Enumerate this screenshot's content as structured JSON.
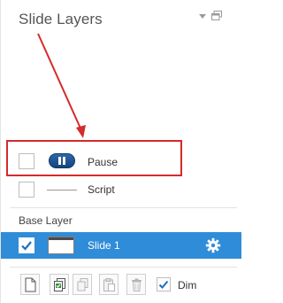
{
  "panel": {
    "title": "Slide Layers"
  },
  "layers": [
    {
      "label": "Pause",
      "checked": false,
      "thumbnail": "pause-button-icon"
    },
    {
      "label": "Script",
      "checked": false,
      "thumbnail": "line-icon"
    }
  ],
  "base_layer": {
    "heading": "Base Layer",
    "slide_label": "Slide 1",
    "checked": true,
    "selected": true
  },
  "toolbar": {
    "buttons": [
      "new-layer-icon",
      "duplicate-layer-icon",
      "copy-icon",
      "paste-icon",
      "delete-icon"
    ],
    "dim_label": "Dim",
    "dim_checked": true
  },
  "colors": {
    "selection": "#2f8cd8",
    "highlight": "#d42b2b",
    "checkmark": "#1e6fc0",
    "pause_button": "#1f4f8a"
  }
}
